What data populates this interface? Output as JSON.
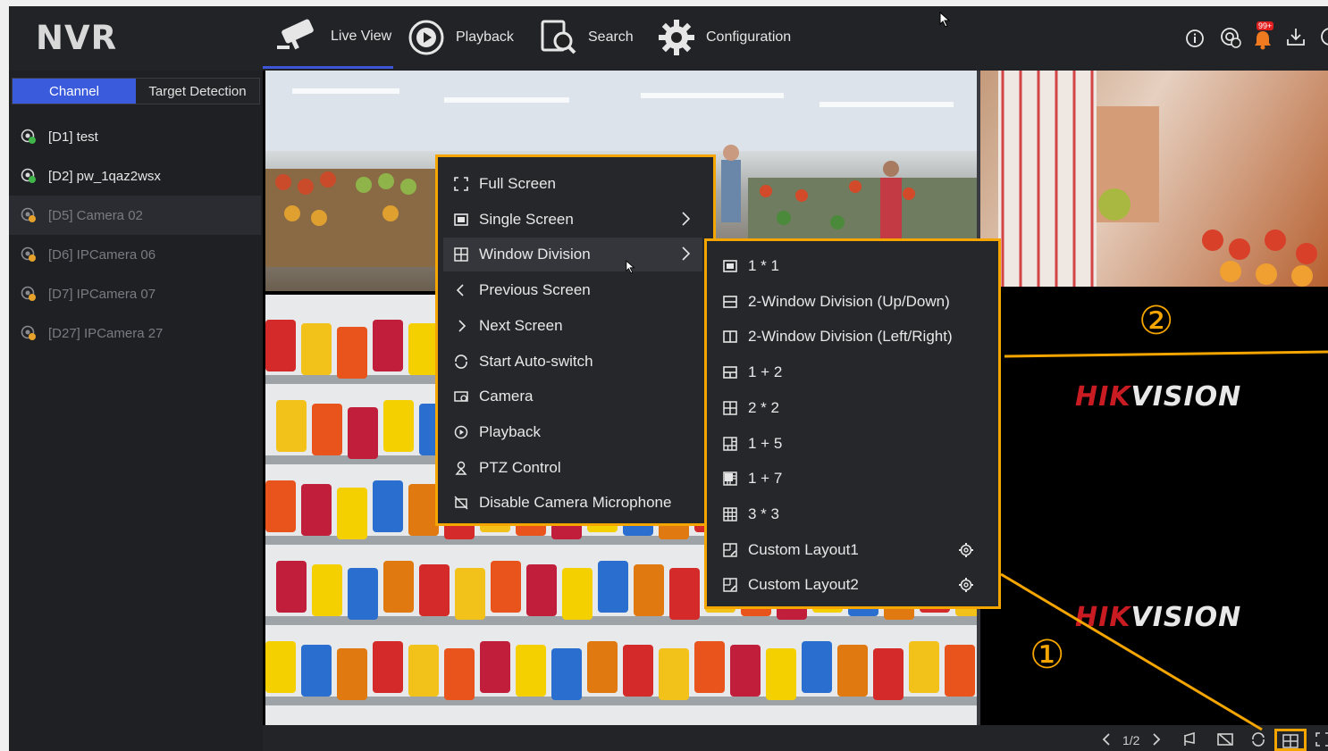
{
  "app": {
    "logo": "NVR"
  },
  "nav": [
    {
      "label": "Live View",
      "icon": "camera-icon",
      "active": true
    },
    {
      "label": "Playback",
      "icon": "playback-icon"
    },
    {
      "label": "Search",
      "icon": "search-icon"
    },
    {
      "label": "Configuration",
      "icon": "gear-icon"
    }
  ],
  "topright": {
    "notification_badge": "99+"
  },
  "tabs": [
    {
      "label": "Channel",
      "active": true
    },
    {
      "label": "Target Detection"
    }
  ],
  "channels": [
    {
      "label": "[D1] test",
      "online": true
    },
    {
      "label": "[D2] pw_1qaz2wsx",
      "online": true
    },
    {
      "label": "[D5] Camera 02",
      "online": false,
      "selected": true
    },
    {
      "label": "[D6] IPCamera 06",
      "online": false
    },
    {
      "label": "[D7] IPCamera 07",
      "online": false
    },
    {
      "label": "[D27] IPCamera 27",
      "online": false
    }
  ],
  "context_menu": [
    {
      "label": "Full Screen",
      "icon": "fullscreen-icon"
    },
    {
      "label": "Single Screen",
      "icon": "single-screen-icon",
      "submenu": true
    },
    {
      "label": "Window Division",
      "icon": "window-division-icon",
      "submenu": true,
      "highlighted": true
    },
    {
      "label": "Previous Screen",
      "icon": "chevron-left-icon"
    },
    {
      "label": "Next Screen",
      "icon": "chevron-right-icon"
    },
    {
      "label": "Start Auto-switch",
      "icon": "auto-switch-icon"
    },
    {
      "label": "Camera",
      "icon": "camera-icon"
    },
    {
      "label": "Playback",
      "icon": "playback-icon"
    },
    {
      "label": "PTZ Control",
      "icon": "ptz-icon"
    },
    {
      "label": "Disable Camera Microphone",
      "icon": "mic-off-icon"
    }
  ],
  "submenu": [
    {
      "label": "1 * 1",
      "icon": "layout-1x1-icon"
    },
    {
      "label": "2-Window Division (Up/Down)",
      "icon": "layout-updown-icon"
    },
    {
      "label": "2-Window Division (Left/Right)",
      "icon": "layout-leftright-icon"
    },
    {
      "label": "1 + 2",
      "icon": "layout-1plus2-icon"
    },
    {
      "label": "2 * 2",
      "icon": "layout-2x2-icon"
    },
    {
      "label": "1 + 5",
      "icon": "layout-1plus5-icon"
    },
    {
      "label": "1 + 7",
      "icon": "layout-1plus7-icon"
    },
    {
      "label": "3 * 3",
      "icon": "layout-3x3-icon"
    },
    {
      "label": "Custom Layout1",
      "icon": "custom-layout-icon",
      "settings": true
    },
    {
      "label": "Custom Layout2",
      "icon": "custom-layout-icon",
      "settings": true
    }
  ],
  "brand": {
    "hik": "HIK",
    "vision": "VISION"
  },
  "bottombar": {
    "page": "1/2"
  },
  "callouts": {
    "one": "①",
    "two": "②"
  },
  "colors": {
    "highlight": "#f5a500",
    "accent": "#3a5bdc",
    "brand_red": "#c81b22"
  }
}
